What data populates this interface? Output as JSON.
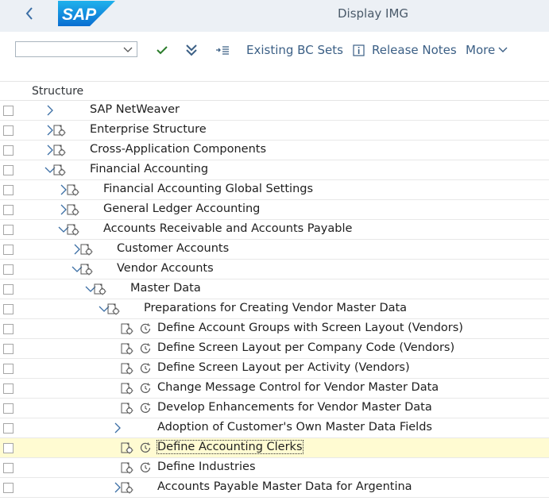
{
  "shell": {
    "title": "Display IMG",
    "logo_text": "SAP",
    "brand_color": "#0a6ed1"
  },
  "toolbar": {
    "select_value": "",
    "check_icon": "check-icon",
    "expand_all_icon": "double-chevron-down-icon",
    "indent_icon": "indent-list-icon",
    "existing_bc_sets": "Existing BC Sets",
    "release_notes": "Release Notes",
    "more": "More"
  },
  "grid": {
    "header": "Structure",
    "rows": [
      {
        "label": "SAP NetWeaver",
        "level": 0,
        "expander": "collapsed",
        "node_icon": false,
        "clock": false
      },
      {
        "label": "Enterprise Structure",
        "level": 0,
        "expander": "collapsed",
        "node_icon": true,
        "clock": false
      },
      {
        "label": "Cross-Application Components",
        "level": 0,
        "expander": "collapsed",
        "node_icon": true,
        "clock": false
      },
      {
        "label": "Financial Accounting",
        "level": 0,
        "expander": "expanded",
        "node_icon": true,
        "clock": false
      },
      {
        "label": "Financial Accounting Global Settings",
        "level": 1,
        "expander": "collapsed",
        "node_icon": true,
        "clock": false
      },
      {
        "label": "General Ledger Accounting",
        "level": 1,
        "expander": "collapsed",
        "node_icon": true,
        "clock": false
      },
      {
        "label": "Accounts Receivable and Accounts Payable",
        "level": 1,
        "expander": "expanded",
        "node_icon": true,
        "clock": false
      },
      {
        "label": "Customer Accounts",
        "level": 2,
        "expander": "collapsed",
        "node_icon": true,
        "clock": false
      },
      {
        "label": "Vendor Accounts",
        "level": 2,
        "expander": "expanded",
        "node_icon": true,
        "clock": false
      },
      {
        "label": "Master Data",
        "level": 3,
        "expander": "expanded",
        "node_icon": true,
        "clock": false
      },
      {
        "label": "Preparations for Creating Vendor Master Data",
        "level": 4,
        "expander": "expanded",
        "node_icon": true,
        "clock": false
      },
      {
        "label": "Define Account Groups with Screen Layout (Vendors)",
        "level": 5,
        "expander": "none",
        "node_icon": true,
        "clock": true
      },
      {
        "label": "Define Screen Layout per Company Code (Vendors)",
        "level": 5,
        "expander": "none",
        "node_icon": true,
        "clock": true
      },
      {
        "label": "Define Screen Layout per Activity (Vendors)",
        "level": 5,
        "expander": "none",
        "node_icon": true,
        "clock": true
      },
      {
        "label": "Change Message Control for Vendor Master Data",
        "level": 5,
        "expander": "none",
        "node_icon": true,
        "clock": true
      },
      {
        "label": "Develop Enhancements for Vendor Master Data",
        "level": 5,
        "expander": "none",
        "node_icon": true,
        "clock": true
      },
      {
        "label": "Adoption of Customer's Own Master Data Fields",
        "level": 5,
        "expander": "collapsed-left",
        "node_icon": false,
        "clock": false
      },
      {
        "label": "Define Accounting Clerks",
        "level": 5,
        "expander": "none",
        "node_icon": true,
        "clock": true,
        "selected": true
      },
      {
        "label": "Define Industries",
        "level": 5,
        "expander": "none",
        "node_icon": true,
        "clock": true
      },
      {
        "label": "Accounts Payable Master Data for Argentina",
        "level": 5,
        "expander": "collapsed-left",
        "node_icon": true,
        "clock": false
      }
    ]
  }
}
